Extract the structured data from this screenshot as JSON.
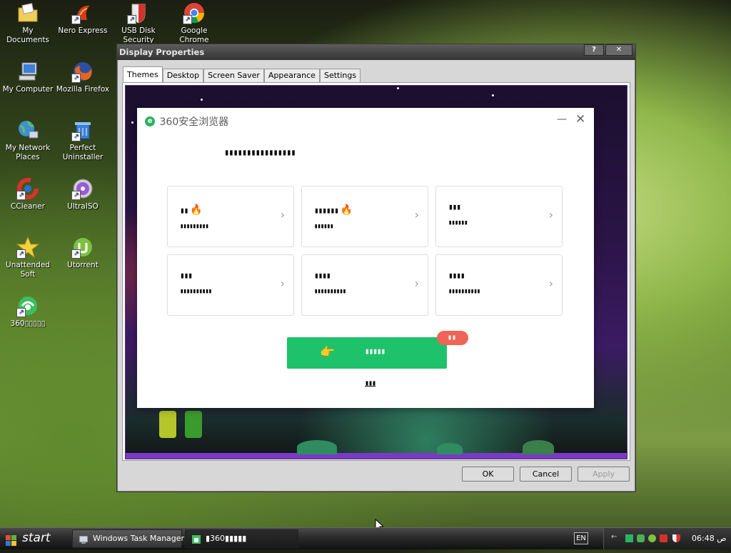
{
  "desktop": {
    "icons": [
      {
        "label": "My Documents",
        "icon": "folder-documents-icon"
      },
      {
        "label": "Nero Express",
        "icon": "nero-express-icon"
      },
      {
        "label": "USB Disk Security",
        "icon": "usb-disk-security-icon"
      },
      {
        "label": "Google Chrome",
        "icon": "chrome-icon"
      },
      {
        "label": "My Computer",
        "icon": "my-computer-icon"
      },
      {
        "label": "Mozilla Firefox",
        "icon": "firefox-icon"
      },
      {
        "label": "My Network Places",
        "icon": "network-places-icon"
      },
      {
        "label": "Perfect Uninstaller",
        "icon": "perfect-uninstaller-icon"
      },
      {
        "label": "CCleaner",
        "icon": "ccleaner-icon"
      },
      {
        "label": "UltraISO",
        "icon": "ultraiso-icon"
      },
      {
        "label": "Unattended Soft",
        "icon": "unattended-soft-icon"
      },
      {
        "label": "Utorrent",
        "icon": "utorrent-icon"
      },
      {
        "label": "360▯▯▯▯▯",
        "icon": "360-browser-icon"
      }
    ]
  },
  "display_properties": {
    "title": "Display Properties",
    "help_button": "?",
    "close_button": "✕",
    "tabs": [
      "Themes",
      "Desktop",
      "Screen Saver",
      "Appearance",
      "Settings"
    ],
    "active_tab": "Themes",
    "buttons": {
      "ok": "OK",
      "cancel": "Cancel",
      "apply": "Apply"
    }
  },
  "browser_dialog": {
    "brand": "360安全浏览器",
    "heading": "▮▮▮▮▮▮▮▮▮▮▮▮▮▮▮▮",
    "cards": [
      {
        "title": "▮▮",
        "subtitle": "▮▮▮▮▮▮▮▮▮",
        "hot": true
      },
      {
        "title": "▮▮▮▮▮▮",
        "subtitle": "▮▮▮▮▮▮",
        "hot": true
      },
      {
        "title": "▮▮▮",
        "subtitle": "▮▮▮▮▮▮",
        "hot": false
      },
      {
        "title": "▮▮▮",
        "subtitle": "▮▮▮▮▮▮▮▮▮▮",
        "hot": false
      },
      {
        "title": "▮▮▮▮",
        "subtitle": "▮▮▮▮▮▮▮▮▮▮",
        "hot": false
      },
      {
        "title": "▮▮▮▮",
        "subtitle": "▮▮▮▮▮▮▮▮▮▮",
        "hot": false
      }
    ],
    "hot_icon": "🔥",
    "chevron": "›",
    "main_button": "▮▮▮▮▮",
    "hand_icon": "👉",
    "badge": "▮▮",
    "link": "▮▮▮",
    "minimize": "—",
    "close": "✕"
  },
  "taskbar": {
    "start_label": "start",
    "items": [
      {
        "label": "Windows Task Manager",
        "icon": "task-manager-icon"
      },
      {
        "label": "▮360▮▮▮▮▮",
        "icon": "360-browser-task-icon"
      }
    ],
    "language": "EN",
    "clock": "06:48 ص"
  }
}
